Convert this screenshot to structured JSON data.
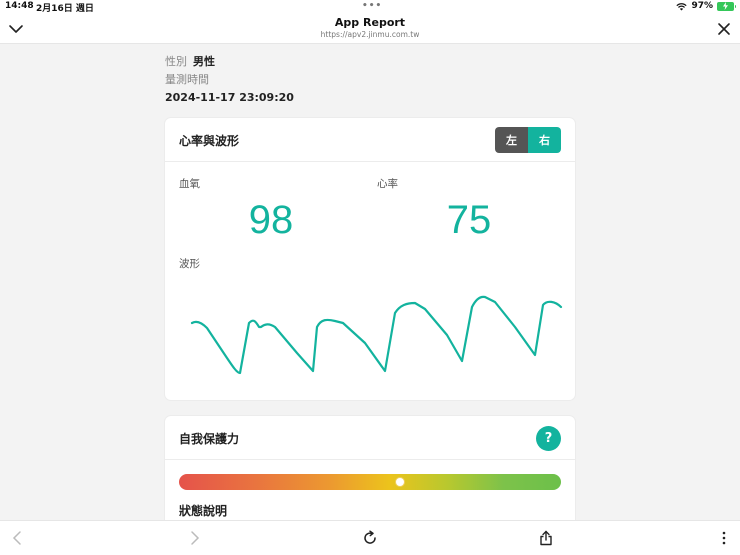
{
  "status_bar": {
    "time": "14:48",
    "date": "2月16日 週日",
    "battery": "97%"
  },
  "header": {
    "title": "App Report",
    "url": "https://apv2.jinmu.com.tw"
  },
  "info": {
    "gender_label": "性別",
    "gender_value": "男性",
    "time_label": "量測時間",
    "time_value": "2024-11-17 23:09:20"
  },
  "heart_card": {
    "title": "心率與波形",
    "toggle": {
      "left": "左",
      "right": "右",
      "selected": "右"
    },
    "spo2_label": "血氧",
    "spo2_value": "98",
    "hr_label": "心率",
    "hr_value": "75",
    "wave_label": "波形"
  },
  "protection_card": {
    "title": "自我保護力",
    "help_label": "?",
    "level": 0.58,
    "status_title": "狀態說明"
  },
  "colors": {
    "accent": "#13b39e",
    "toggle_inactive": "#555555",
    "battery": "#34c759"
  },
  "icons": {
    "nav_left": "chevron-down-icon",
    "nav_right": "close-icon",
    "toolbar": [
      "back-icon",
      "forward-icon",
      "reload-icon",
      "share-icon",
      "more-icon"
    ]
  }
}
